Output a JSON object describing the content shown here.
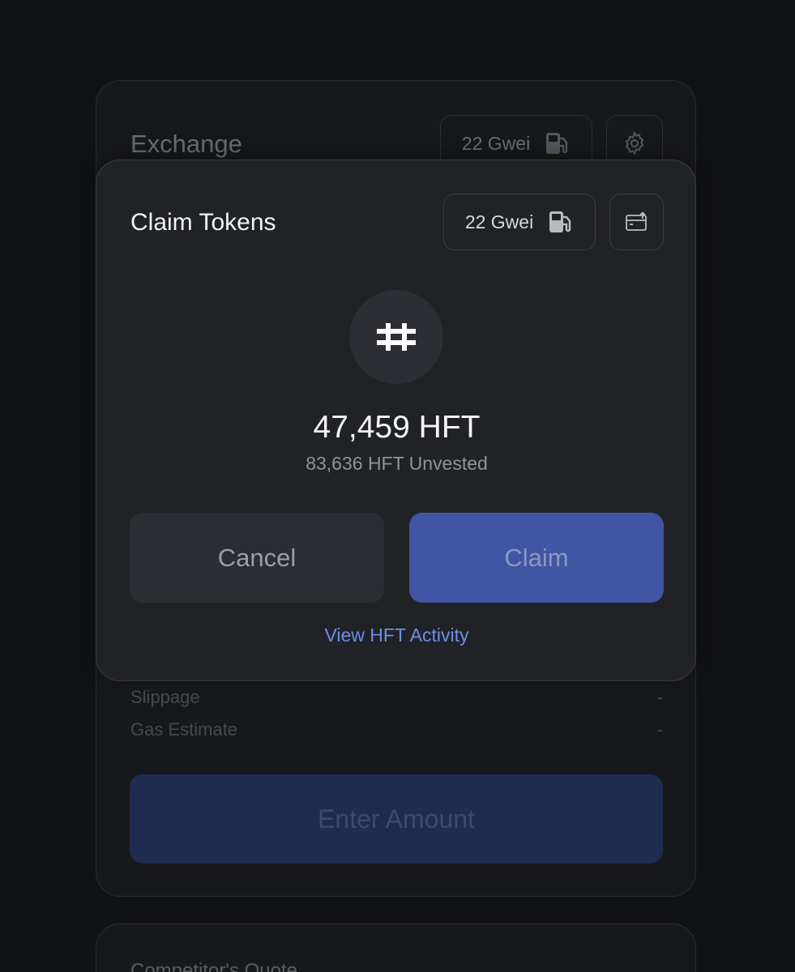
{
  "exchange": {
    "title": "Exchange",
    "gas_label": "22 Gwei",
    "rows": [
      {
        "label": "Slippage",
        "value": "-"
      },
      {
        "label": "Gas Estimate",
        "value": "-"
      }
    ],
    "submit_label": "Enter Amount"
  },
  "competitor": {
    "title": "Competitor's Quote"
  },
  "claim_modal": {
    "title": "Claim Tokens",
    "gas_label": "22 Gwei",
    "amount": "47,459 HFT",
    "unvested": "83,636 HFT Unvested",
    "cancel_label": "Cancel",
    "claim_label": "Claim",
    "activity_link": "View HFT Activity"
  },
  "colors": {
    "background": "#111214",
    "modal": "#212226",
    "accent": "#4056a4",
    "link": "#6d8ee8"
  },
  "icons": {
    "gas": "gas-pump-icon",
    "settings": "gear-icon",
    "wallet": "wallet-icon",
    "token": "hashflow-logo-icon"
  }
}
